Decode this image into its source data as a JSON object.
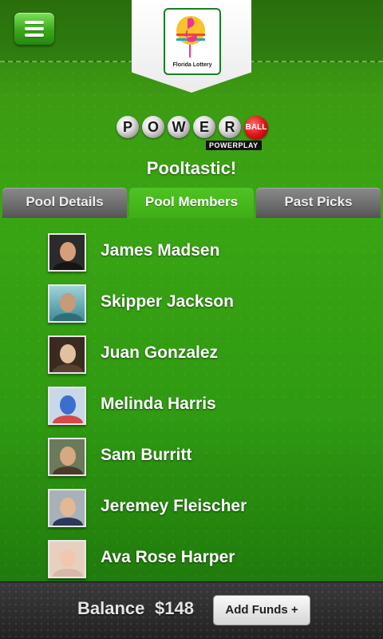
{
  "header": {
    "brand_text": "Florida Lottery",
    "accent_color": "#3fae17"
  },
  "game": {
    "logo_letters": [
      "P",
      "O",
      "W",
      "E",
      "R"
    ],
    "logo_ball_text": "BALL",
    "logo_sub_text": "POWERPLAY"
  },
  "pool": {
    "title": "Pooltastic!"
  },
  "tabs": [
    {
      "label": "Pool Details",
      "selected": false
    },
    {
      "label": "Pool Members",
      "selected": true
    },
    {
      "label": "Past Picks",
      "selected": false
    }
  ],
  "members": [
    {
      "name": "James Madsen"
    },
    {
      "name": "Skipper Jackson"
    },
    {
      "name": "Juan Gonzalez"
    },
    {
      "name": "Melinda Harris"
    },
    {
      "name": "Sam Burritt"
    },
    {
      "name": "Jeremey Fleischer"
    },
    {
      "name": "Ava Rose Harper"
    }
  ],
  "footer": {
    "balance_label": "Balance",
    "balance_amount": "$148",
    "add_funds_label": "Add Funds +"
  }
}
